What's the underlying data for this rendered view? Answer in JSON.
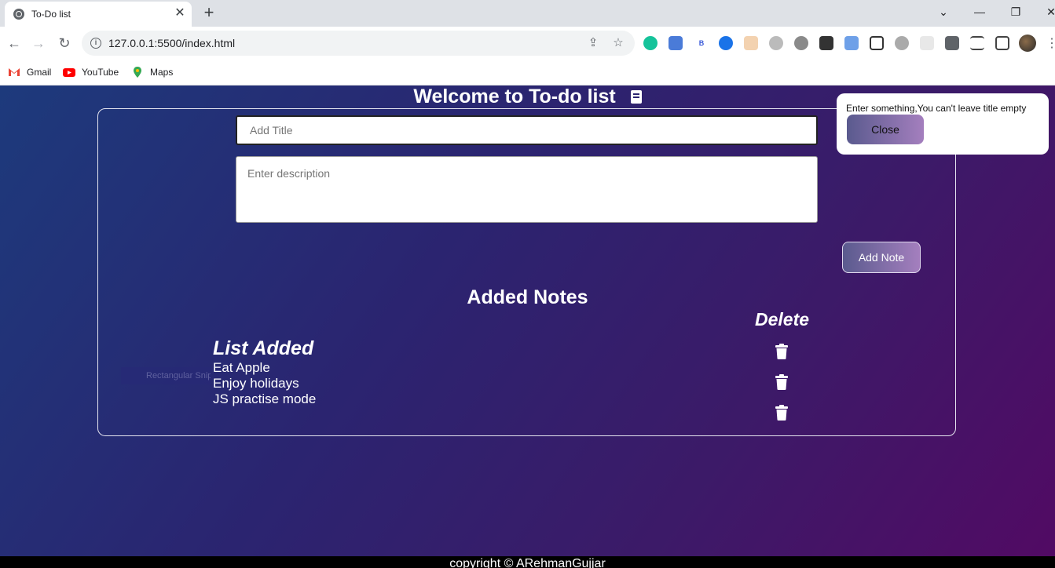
{
  "browser": {
    "tab_title": "To-Do list",
    "tab_close": "✕",
    "new_tab": "+",
    "url": "127.0.0.1:5500/index.html",
    "bookmarks": [
      {
        "label": "Gmail"
      },
      {
        "label": "YouTube"
      },
      {
        "label": "Maps"
      }
    ]
  },
  "page": {
    "title": "Welcome to To-do list",
    "title_input_placeholder": "Add Title",
    "description_placeholder": "Enter description",
    "add_button_label": "Add Note",
    "notes_heading": "Added Notes",
    "delete_heading": "Delete",
    "list_heading": "List Added",
    "notes": [
      "Eat Apple",
      "Enjoy holidays",
      "JS practise mode"
    ],
    "ghost_text": "Rectangular Snip",
    "footer": "copyright © ARehmanGujjar"
  },
  "toast": {
    "message": "Enter something,You can't leave title empty",
    "close_label": "Close"
  },
  "colors": {
    "gradient_start": "#1d3a7c",
    "gradient_end": "#520a64",
    "button_start": "#5a5a8e",
    "button_end": "#a47fbe"
  }
}
